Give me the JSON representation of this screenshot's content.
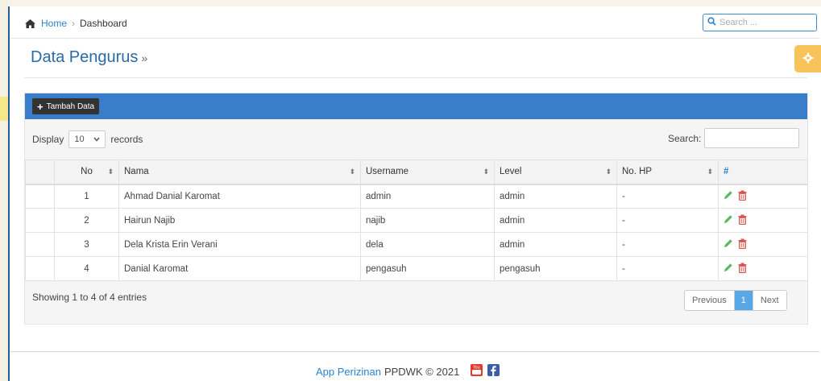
{
  "breadcrumb": {
    "home": "Home",
    "separator": "›",
    "current": "Dashboard"
  },
  "search": {
    "placeholder": "Search ..."
  },
  "page": {
    "title": "Data Pengurus",
    "title_suffix": "»"
  },
  "toolbar": {
    "add_label": "Tambah Data"
  },
  "table_controls": {
    "display_label": "Display",
    "page_length": "10",
    "records_label": "records",
    "search_label": "Search:"
  },
  "table": {
    "columns": [
      "No",
      "Nama",
      "Username",
      "Level",
      "No. HP",
      "#"
    ],
    "rows": [
      {
        "no": "1",
        "nama": "Ahmad Danial Karomat",
        "username": "admin",
        "level": "admin",
        "hp": "-"
      },
      {
        "no": "2",
        "nama": "Hairun Najib",
        "username": "najib",
        "level": "admin",
        "hp": "-"
      },
      {
        "no": "3",
        "nama": "Dela Krista Erin Verani",
        "username": "dela",
        "level": "admin",
        "hp": "-"
      },
      {
        "no": "4",
        "nama": "Danial Karomat",
        "username": "pengasuh",
        "level": "pengasuh",
        "hp": "-"
      }
    ]
  },
  "footer_info": {
    "showing": "Showing 1 to 4 of 4 entries"
  },
  "pagination": {
    "previous": "Previous",
    "current_page": "1",
    "next": "Next"
  },
  "footer": {
    "app_name": "App Perizinan",
    "org": "PPDWK © 2021"
  },
  "colors": {
    "accent": "#3a7dc9",
    "link": "#2b82d0",
    "edit": "#5cb85c",
    "delete": "#d9534f",
    "gear": "#f7c35a"
  },
  "icons": {
    "home": "home-icon",
    "search": "search-icon",
    "gear": "gear-icon",
    "edit": "pencil-icon",
    "delete": "trash-icon",
    "youtube": "youtube-icon",
    "facebook": "facebook-icon"
  }
}
